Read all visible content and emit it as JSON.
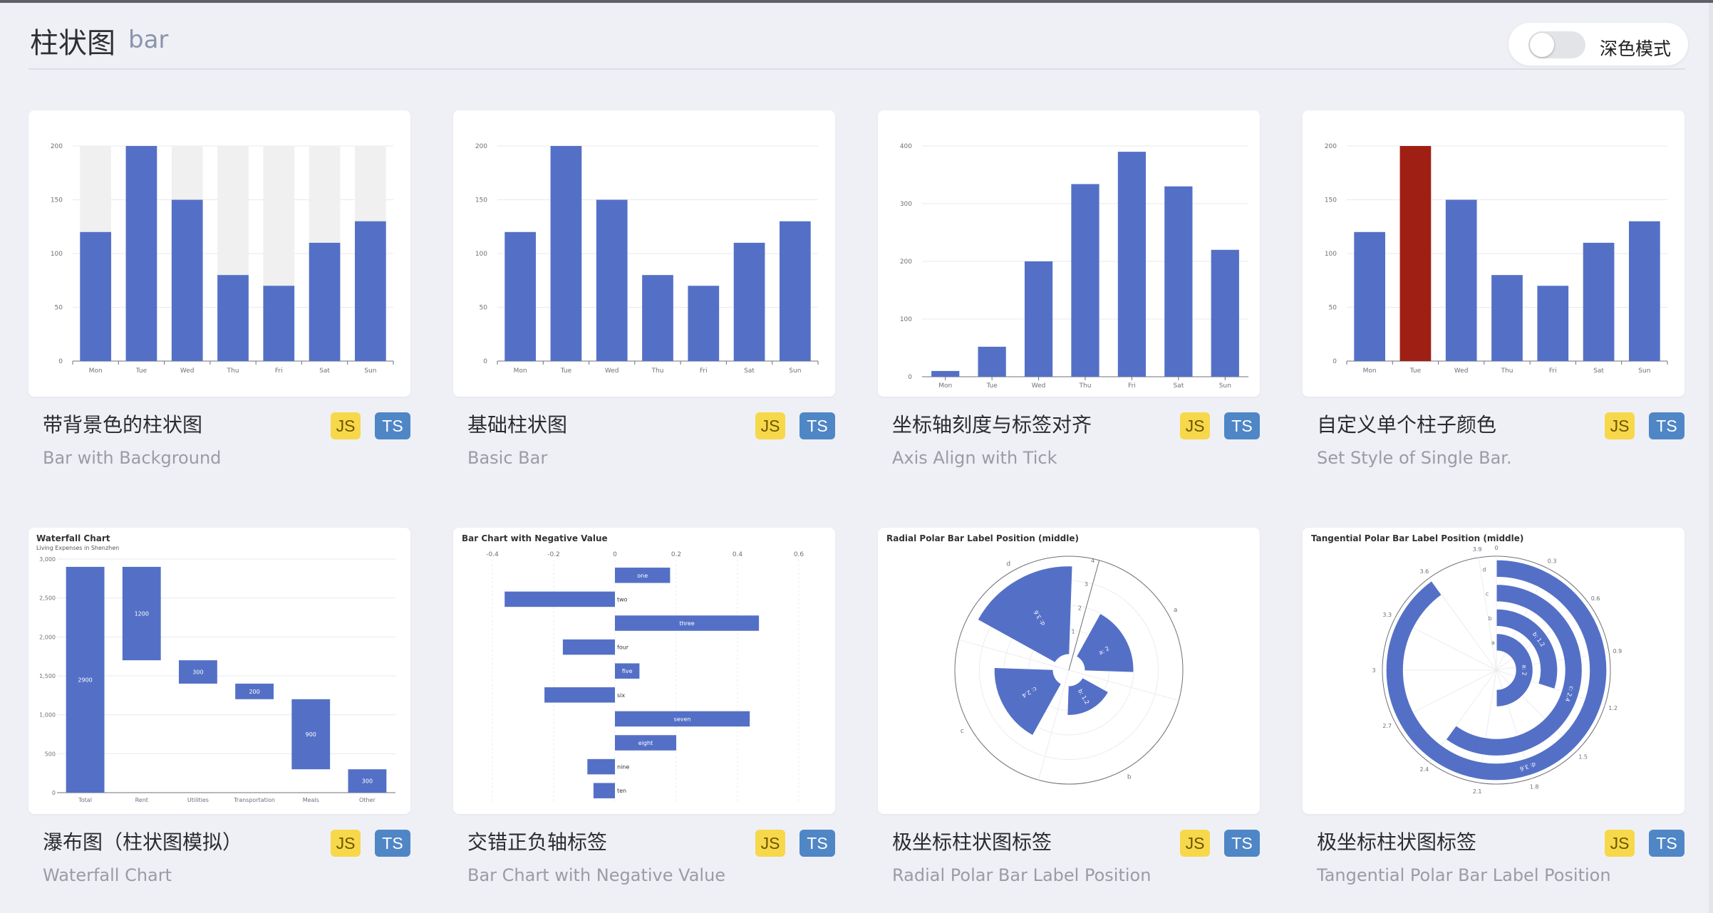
{
  "header": {
    "title": "柱状图",
    "subtitle": "bar",
    "dark_mode_label": "深色模式",
    "dark_mode_on": false
  },
  "colors": {
    "bar": "#5470c6",
    "highlight_bar": "#a01f14",
    "background_bar": "#f0f0f0",
    "js_badge": "#f7d84a",
    "ts_badge": "#4f86c6"
  },
  "cards": [
    {
      "title": "带背景色的柱状图",
      "subtitle": "Bar with Background",
      "js_label": "JS",
      "ts_label": "TS"
    },
    {
      "title": "基础柱状图",
      "subtitle": "Basic Bar",
      "js_label": "JS",
      "ts_label": "TS"
    },
    {
      "title": "坐标轴刻度与标签对齐",
      "subtitle": "Axis Align with Tick",
      "js_label": "JS",
      "ts_label": "TS"
    },
    {
      "title": "自定义单个柱子颜色",
      "subtitle": "Set Style of Single Bar.",
      "js_label": "JS",
      "ts_label": "TS"
    },
    {
      "title": "瀑布图（柱状图模拟）",
      "subtitle": "Waterfall Chart",
      "js_label": "JS",
      "ts_label": "TS"
    },
    {
      "title": "交错正负轴标签",
      "subtitle": "Bar Chart with Negative Value",
      "js_label": "JS",
      "ts_label": "TS"
    },
    {
      "title": "极坐标柱状图标签",
      "subtitle": "Radial Polar Bar Label Position",
      "js_label": "JS",
      "ts_label": "TS"
    },
    {
      "title": "极坐标柱状图标签",
      "subtitle": "Tangential Polar Bar Label Position",
      "js_label": "JS",
      "ts_label": "TS"
    }
  ],
  "chart_data": [
    {
      "type": "bar",
      "categories": [
        "Mon",
        "Tue",
        "Wed",
        "Thu",
        "Fri",
        "Sat",
        "Sun"
      ],
      "values": [
        120,
        200,
        150,
        80,
        70,
        110,
        130
      ],
      "background_bar": true,
      "ylim": [
        0,
        200
      ],
      "yticks": [
        0,
        50,
        100,
        150,
        200
      ]
    },
    {
      "type": "bar",
      "categories": [
        "Mon",
        "Tue",
        "Wed",
        "Thu",
        "Fri",
        "Sat",
        "Sun"
      ],
      "values": [
        120,
        200,
        150,
        80,
        70,
        110,
        130
      ],
      "ylim": [
        0,
        200
      ],
      "yticks": [
        0,
        50,
        100,
        150,
        200
      ]
    },
    {
      "type": "bar",
      "categories": [
        "Mon",
        "Tue",
        "Wed",
        "Thu",
        "Fri",
        "Sat",
        "Sun"
      ],
      "values": [
        10,
        52,
        200,
        334,
        390,
        330,
        220
      ],
      "ylim": [
        0,
        400
      ],
      "yticks": [
        0,
        100,
        200,
        300,
        400
      ]
    },
    {
      "type": "bar",
      "categories": [
        "Mon",
        "Tue",
        "Wed",
        "Thu",
        "Fri",
        "Sat",
        "Sun"
      ],
      "values": [
        120,
        200,
        150,
        80,
        70,
        110,
        130
      ],
      "highlight_index": 1,
      "ylim": [
        0,
        200
      ],
      "yticks": [
        0,
        50,
        100,
        150,
        200
      ]
    },
    {
      "type": "bar",
      "title": "Waterfall Chart",
      "subtitle": "Living Expenses in Shenzhen",
      "categories": [
        "Total",
        "Rent",
        "Utilities",
        "Transportation",
        "Meals",
        "Other"
      ],
      "base": [
        0,
        1700,
        1400,
        1200,
        300,
        0
      ],
      "values": [
        2900,
        1200,
        300,
        200,
        900,
        300
      ],
      "ylim": [
        0,
        3000
      ],
      "yticks": [
        "0",
        "500",
        "1,000",
        "1,500",
        "2,000",
        "2,500",
        "3,000"
      ]
    },
    {
      "type": "bar",
      "title": "Bar Chart with Negative Value",
      "orientation": "horizontal",
      "categories": [
        "one",
        "two",
        "three",
        "four",
        "five",
        "six",
        "seven",
        "eight",
        "nine",
        "ten"
      ],
      "values": [
        0.18,
        -0.36,
        0.47,
        -0.17,
        0.08,
        -0.23,
        0.44,
        0.2,
        -0.09,
        -0.07
      ],
      "xlim": [
        -0.4,
        0.6
      ],
      "xticks": [
        "-0.4",
        "-0.2",
        "0",
        "0.2",
        "0.4",
        "0.6"
      ]
    },
    {
      "type": "bar",
      "title": "Radial Polar Bar Label Position (middle)",
      "polar": "radial",
      "categories": [
        "a",
        "b",
        "c",
        "d"
      ],
      "values": [
        2,
        1.2,
        2.4,
        3.6
      ],
      "labels": [
        "a: 2",
        "b: 1.2",
        "c: 2.4",
        "d: 3.6"
      ],
      "radius_ticks": [
        "1",
        "2",
        "3",
        "4"
      ],
      "rmax": 4
    },
    {
      "type": "bar",
      "title": "Tangential Polar Bar Label Position (middle)",
      "polar": "tangential",
      "categories": [
        "a",
        "b",
        "c",
        "d"
      ],
      "values": [
        2,
        1.2,
        2.4,
        3.6
      ],
      "labels": [
        "a: 2",
        "b: 1.2",
        "c: 2.4",
        "d: 3.6"
      ],
      "angle_ticks": [
        "0",
        "0.3",
        "0.6",
        "0.9",
        "1.2",
        "1.5",
        "1.8",
        "2.1",
        "2.4",
        "2.7",
        "3",
        "3.3",
        "3.6",
        "3.9"
      ],
      "amax": 4
    }
  ]
}
